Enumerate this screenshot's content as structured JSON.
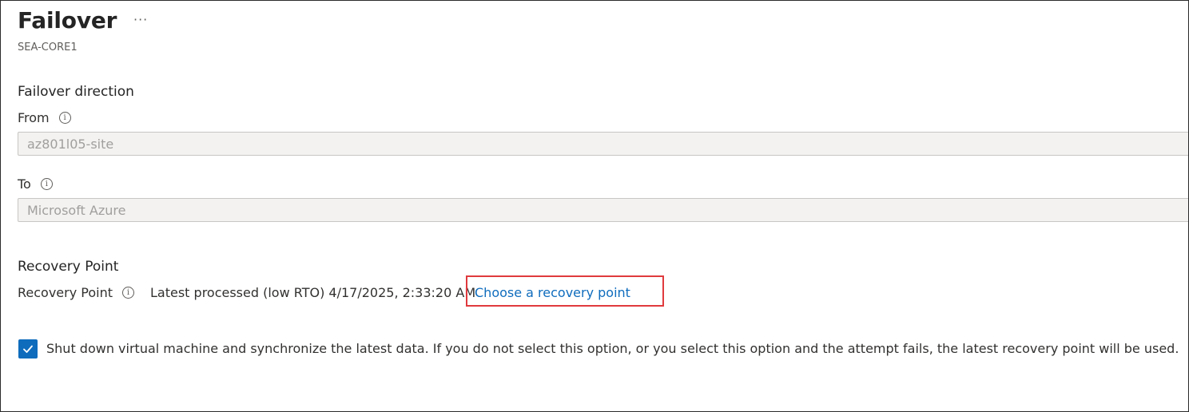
{
  "header": {
    "title": "Failover",
    "more_label": "···",
    "subtitle": "SEA-CORE1"
  },
  "failover_direction": {
    "heading": "Failover direction",
    "from": {
      "label": "From",
      "value": "az801l05-site"
    },
    "to": {
      "label": "To",
      "value": "Microsoft Azure"
    }
  },
  "recovery_point": {
    "heading": "Recovery Point",
    "label": "Recovery Point",
    "value": "Latest processed (low RTO) 4/17/2025, 2:33:20 AM",
    "link": "Choose a recovery point",
    "highlight_color": "#e03a3e"
  },
  "shutdown_option": {
    "checked": true,
    "label": "Shut down virtual machine and synchronize the latest data. If you do not select this option, or you select this option and the attempt fails, the latest recovery point will be used."
  },
  "icons": {
    "info": "info-icon",
    "more": "more-icon",
    "check": "checkmark-icon"
  },
  "colors": {
    "accent": "#0f6cbd",
    "highlight": "#e03a3e"
  }
}
